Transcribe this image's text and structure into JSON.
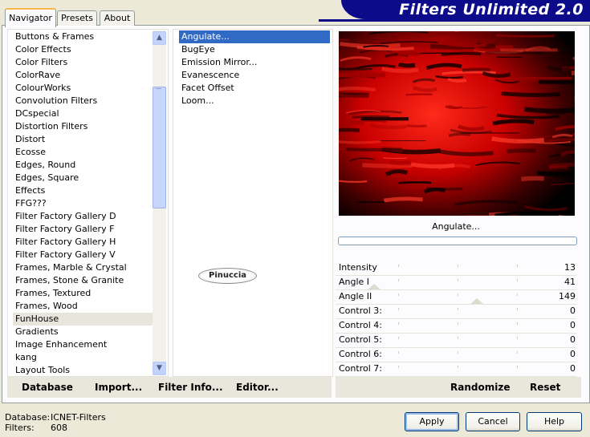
{
  "tabs": [
    {
      "label": "Navigator",
      "active": true
    },
    {
      "label": "Presets",
      "active": false
    },
    {
      "label": "About",
      "active": false
    }
  ],
  "banner": {
    "title": "Filters Unlimited 2.0"
  },
  "categories": {
    "items": [
      "Buttons & Frames",
      "Color Effects",
      "Color Filters",
      "ColorRave",
      "ColourWorks",
      "Convolution Filters",
      "DCspecial",
      "Distortion Filters",
      "Distort",
      "Ecosse",
      "Edges, Round",
      "Edges, Square",
      "Effects",
      "FFG???",
      "Filter Factory Gallery D",
      "Filter Factory Gallery F",
      "Filter Factory Gallery H",
      "Filter Factory Gallery V",
      "Frames, Marble & Crystal",
      "Frames, Stone & Granite",
      "Frames, Textured",
      "Frames, Wood",
      "FunHouse",
      "Gradients",
      "Image Enhancement",
      "kang",
      "Layout Tools"
    ],
    "selected": "FunHouse",
    "scroll_up_icon": "chevron-up-icon",
    "scroll_down_icon": "chevron-down-icon"
  },
  "filters": {
    "items": [
      "Angulate...",
      "BugEye",
      "Emission Mirror...",
      "Evanescence",
      "Facet Offset",
      "Loom..."
    ],
    "selected": "Angulate..."
  },
  "watermark": {
    "text": "Pinuccia"
  },
  "preview": {
    "caption": "Angulate...",
    "progress": 0
  },
  "controls": [
    {
      "label": "Intensity",
      "value": 13
    },
    {
      "label": "Angle I",
      "value": 41
    },
    {
      "label": "Angle II",
      "value": 149
    },
    {
      "label": "Control 3:",
      "value": 0
    },
    {
      "label": "Control 4:",
      "value": 0
    },
    {
      "label": "Control 5:",
      "value": 0
    },
    {
      "label": "Control 6:",
      "value": 0
    },
    {
      "label": "Control 7:",
      "value": 0
    }
  ],
  "toolbar": {
    "database": "Database",
    "import": "Import...",
    "filter_info": "Filter Info...",
    "editor": "Editor...",
    "randomize": "Randomize",
    "reset": "Reset"
  },
  "status": {
    "database_label": "Database:",
    "database_value": "ICNET-Filters",
    "filters_label": "Filters:",
    "filters_value": "608"
  },
  "buttons": {
    "apply": "Apply",
    "cancel": "Cancel",
    "help": "Help"
  },
  "colors": {
    "banner": "#0c0c8a",
    "tab_accent": "#f7b64a",
    "preview_red": "#d10000"
  }
}
